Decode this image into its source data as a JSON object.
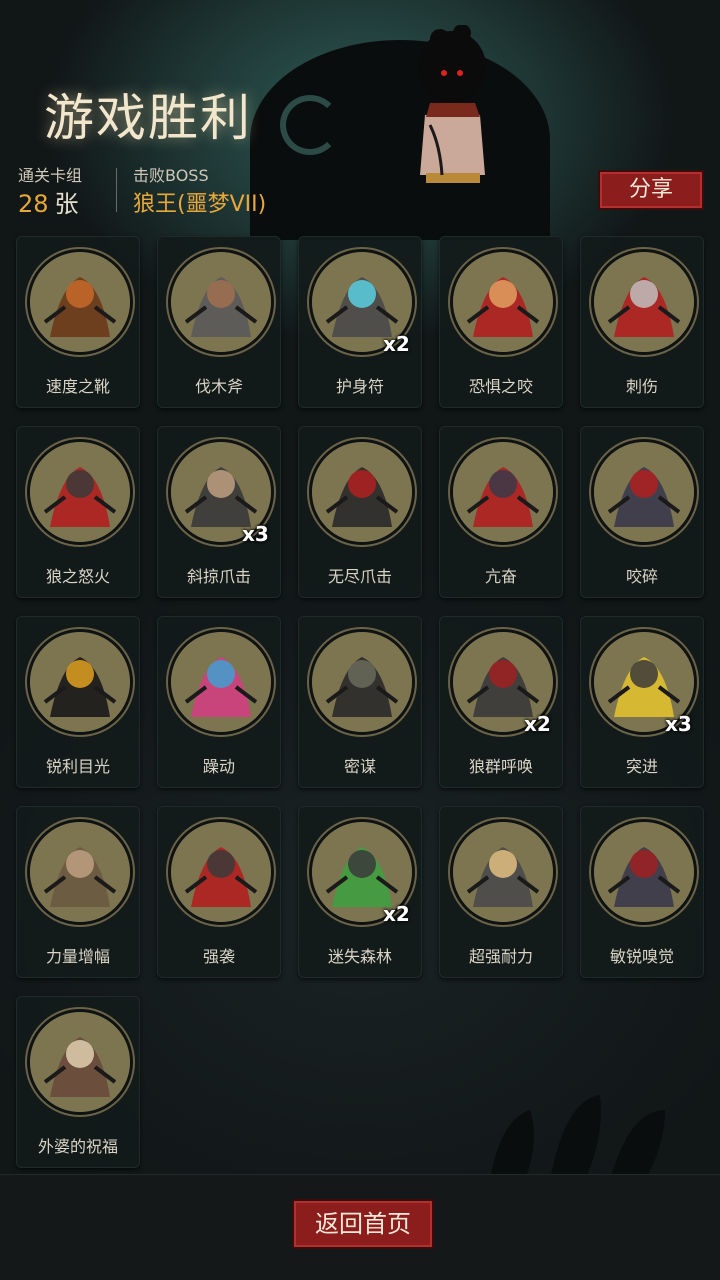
{
  "header": {
    "title": "游戏胜利",
    "stats": {
      "deck_label": "通关卡组",
      "deck_count": "28",
      "deck_unit": "张",
      "boss_label": "击败BOSS",
      "boss_name": "狼王(噩梦VII)"
    },
    "share_label": "分享"
  },
  "cards": [
    {
      "label": "速度之靴",
      "count": "",
      "icon": "boot-icon"
    },
    {
      "label": "伐木斧",
      "count": "",
      "icon": "axe-icon"
    },
    {
      "label": "护身符",
      "count": "x2",
      "icon": "amulet-icon"
    },
    {
      "label": "恐惧之咬",
      "count": "",
      "icon": "skull-bite-icon"
    },
    {
      "label": "刺伤",
      "count": "",
      "icon": "dagger-icon"
    },
    {
      "label": "狼之怒火",
      "count": "",
      "icon": "wolf-rage-icon"
    },
    {
      "label": "斜掠爪击",
      "count": "x3",
      "icon": "wolf-slash-icon"
    },
    {
      "label": "无尽爪击",
      "count": "",
      "icon": "claw-icon"
    },
    {
      "label": "亢奋",
      "count": "",
      "icon": "wolf-frenzy-icon"
    },
    {
      "label": "咬碎",
      "count": "",
      "icon": "wolf-crush-icon"
    },
    {
      "label": "锐利目光",
      "count": "",
      "icon": "wolf-eyes-icon"
    },
    {
      "label": "躁动",
      "count": "",
      "icon": "restless-icon"
    },
    {
      "label": "密谋",
      "count": "",
      "icon": "hooded-figures-icon"
    },
    {
      "label": "狼群呼唤",
      "count": "x2",
      "icon": "wolf-howl-icon"
    },
    {
      "label": "突进",
      "count": "x3",
      "icon": "wolf-dash-icon"
    },
    {
      "label": "力量增幅",
      "count": "",
      "icon": "log-carry-icon"
    },
    {
      "label": "强袭",
      "count": "",
      "icon": "wolf-assault-icon"
    },
    {
      "label": "迷失森林",
      "count": "x2",
      "icon": "lost-forest-icon"
    },
    {
      "label": "超强耐力",
      "count": "",
      "icon": "endurance-icon"
    },
    {
      "label": "敏锐嗅觉",
      "count": "",
      "icon": "wolf-sniff-icon"
    },
    {
      "label": "外婆的祝福",
      "count": "",
      "icon": "grandma-icon"
    }
  ],
  "footer": {
    "home_label": "返回首页"
  },
  "colors": {
    "accent_red": "#8c1d1d",
    "gold": "#e9a83a",
    "card_art_bg": "#7d7550"
  }
}
